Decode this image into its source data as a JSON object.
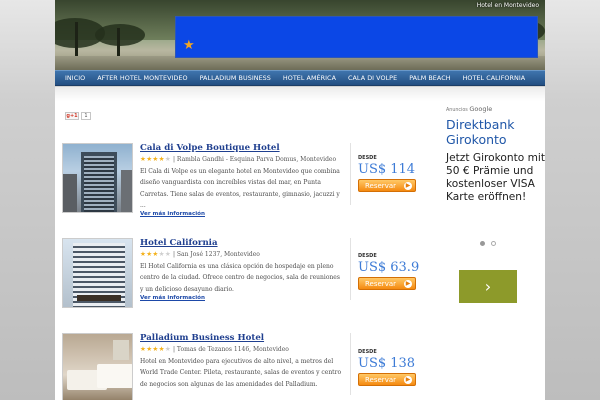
{
  "header": {
    "site_name": "Hotel en Montevideo",
    "banner_color": "#0b47e6"
  },
  "nav": {
    "items": [
      "INICIO",
      "AFTER HOTEL MONTEVIDEO",
      "PALLADIUM BUSINESS",
      "HOTEL AMÉRICA",
      "CALA DI VOLPE",
      "PALM BEACH",
      "HOTEL CALIFORNIA"
    ]
  },
  "share": {
    "gplus_label": "g+1",
    "count": "1"
  },
  "listings": [
    {
      "name": "Cala di Volpe Boutique Hotel",
      "stars": 4,
      "address": "Rambla Gandhi - Esquina Parva Domus, Montevideo",
      "description": "El Cala di Volpe es un elegante hotel en Montevideo que combina diseño vanguardista con increíbles vistas del mar, en Punta Carretas. Tiene salas de eventos, restaurante, gimnasio, jacuzzi y ...",
      "more": "Ver más información",
      "desde": "DESDE",
      "price": "US$ 114",
      "button": "Reservar"
    },
    {
      "name": "Hotel California",
      "stars": 3,
      "address": "San José 1237, Montevideo",
      "description": "El Hotel California es una clásica opción de hospedaje en pleno centro de la ciudad. Ofrece centro de negocios, sala de reuniones y un delicioso desayuno diario.",
      "more": "Ver más información",
      "desde": "DESDE",
      "price": "US$ 63.9",
      "button": "Reservar"
    },
    {
      "name": "Palladium Business Hotel",
      "stars": 4,
      "address": "Tomas de Tezanos 1146, Montevideo",
      "description": "Hotel en Montevideo para ejecutivos de alto nivel, a metros del World Trade Center. Pileta, restaurante, salas de eventos y centro de negocios son algunas de las amenidades del Palladium.",
      "more": "",
      "desde": "DESDE",
      "price": "US$ 138",
      "button": "Reservar"
    }
  ],
  "ad": {
    "byline_prefix": "Anuncios",
    "byline_brand": "Google",
    "title": "Direktbank Girokonto",
    "body": "Jetzt Girokonto mit 50 € Prämie und kostenloser VISA Karte eröffnen!",
    "go_symbol": "›",
    "dots_count": 2,
    "active_dot": 0
  }
}
